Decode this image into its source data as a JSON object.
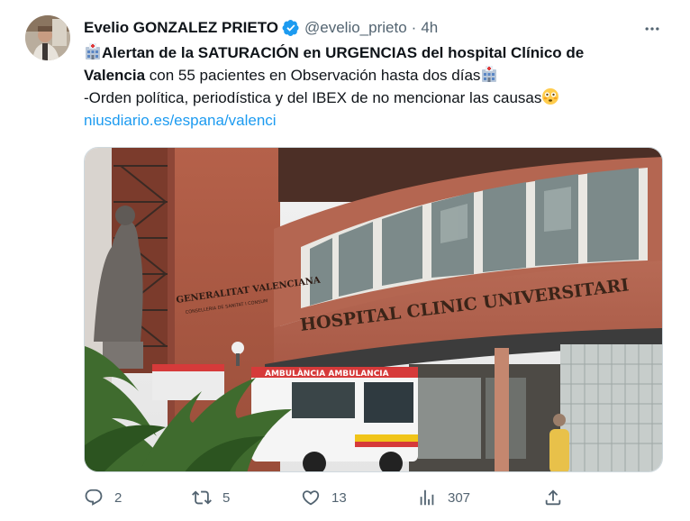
{
  "tweet": {
    "author_name": "Evelio GONZALEZ PRIETO",
    "handle": "@evelio_prieto",
    "separator": "·",
    "time": "4h",
    "text": {
      "line1_bold": "Alertan de la SATURACIÓN en URGENCIAS del hospital Clínico de",
      "line2_bold": "Valencia",
      "line2_rest": " con 55 pacientes en Observación hasta dos días",
      "line3": "-Orden política, periodística y del IBEX de no mencionar las causas",
      "link": "niusdiario.es/espana/valenci"
    },
    "media": {
      "sign_main": "HOSPITAL CLINIC UNIVERSITARI",
      "sign_small": "GENERALITAT VALENCIANA",
      "sign_small_sub": "CONSELLERIA DE SANITAT I CONSUM",
      "ambulance_label": "AMBULÀNCIA   AMBULANCIA"
    },
    "actions": {
      "replies": "2",
      "retweets": "5",
      "likes": "13",
      "views": "307"
    }
  },
  "colors": {
    "text_primary": "#0f1419",
    "text_secondary": "#536471",
    "link": "#1d9bf0",
    "verified": "#1d9bf0"
  },
  "icons": [
    "more-icon",
    "verified-icon",
    "hospital-emoji-icon",
    "flushed-emoji-icon",
    "reply-icon",
    "retweet-icon",
    "like-icon",
    "views-icon",
    "share-icon"
  ]
}
